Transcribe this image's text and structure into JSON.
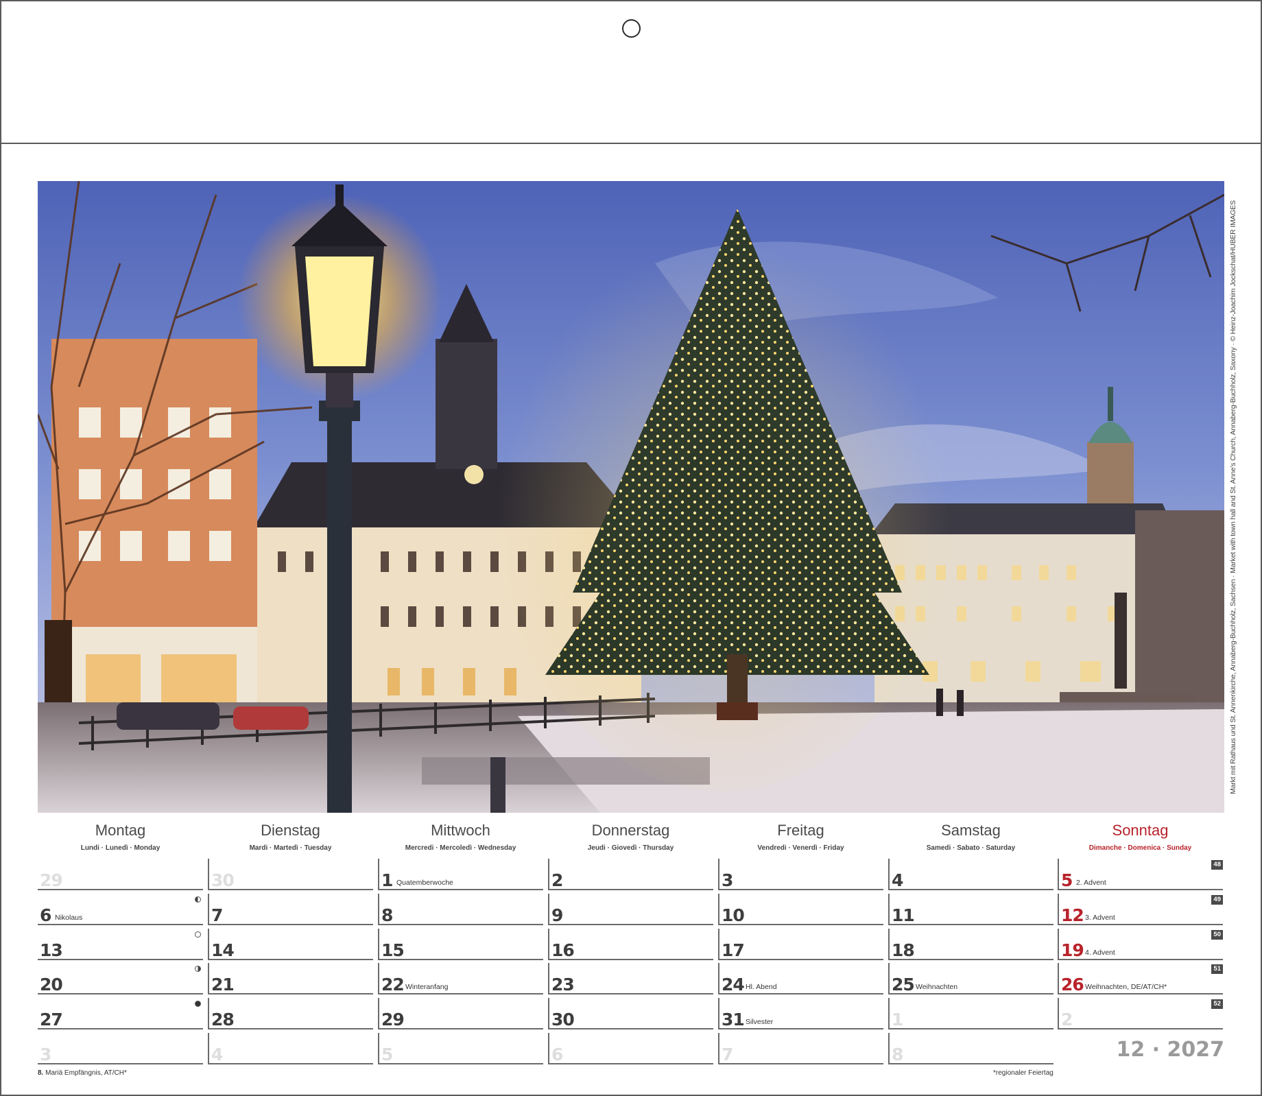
{
  "photo": {
    "credit": "Markt mit Rathaus und St. Annenkirche, Annaberg-Buchholz, Sachsen · Market with town hall and St. Anne’s Church, Annaberg-Buchholz, Saxony · © Heinz-Joachim Jockschat/HUBER IMAGES"
  },
  "weekdays": [
    {
      "name": "Montag",
      "sub": "Lundi · Lunedì · Monday"
    },
    {
      "name": "Dienstag",
      "sub": "Mardi · Martedì · Tuesday"
    },
    {
      "name": "Mittwoch",
      "sub": "Mercredi · Mercoledì · Wednesday"
    },
    {
      "name": "Donnerstag",
      "sub": "Jeudi · Giovedì · Thursday"
    },
    {
      "name": "Freitag",
      "sub": "Vendredi · Venerdì · Friday"
    },
    {
      "name": "Samstag",
      "sub": "Samedi · Sabato · Saturday"
    },
    {
      "name": "Sonntag",
      "sub": "Dimanche · Domenica · Sunday"
    }
  ],
  "weeks": [
    {
      "week_no": "48",
      "days": [
        {
          "n": "29",
          "state": "dim"
        },
        {
          "n": "30",
          "state": "dim"
        },
        {
          "n": "1",
          "note": "Quatemberwoche"
        },
        {
          "n": "2"
        },
        {
          "n": "3"
        },
        {
          "n": "4"
        },
        {
          "n": "5",
          "state": "red",
          "note": "2. Advent"
        }
      ]
    },
    {
      "week_no": "49",
      "days": [
        {
          "n": "6",
          "note": "Nikolaus",
          "moon": "lq"
        },
        {
          "n": "7"
        },
        {
          "n": "8"
        },
        {
          "n": "9"
        },
        {
          "n": "10"
        },
        {
          "n": "11"
        },
        {
          "n": "12",
          "state": "red",
          "note": "3. Advent"
        }
      ]
    },
    {
      "week_no": "50",
      "days": [
        {
          "n": "13",
          "moon": "full"
        },
        {
          "n": "14"
        },
        {
          "n": "15"
        },
        {
          "n": "16"
        },
        {
          "n": "17"
        },
        {
          "n": "18"
        },
        {
          "n": "19",
          "state": "red",
          "note": "4. Advent"
        }
      ]
    },
    {
      "week_no": "51",
      "days": [
        {
          "n": "20",
          "moon": "fq"
        },
        {
          "n": "21"
        },
        {
          "n": "22",
          "note": "Winteranfang"
        },
        {
          "n": "23"
        },
        {
          "n": "24",
          "note": "Hl. Abend"
        },
        {
          "n": "25",
          "note": "Weihnachten"
        },
        {
          "n": "26",
          "state": "red",
          "note": "Weihnachten, DE/AT/CH*"
        }
      ]
    },
    {
      "week_no": "52",
      "days": [
        {
          "n": "27",
          "moon": "new"
        },
        {
          "n": "28"
        },
        {
          "n": "29"
        },
        {
          "n": "30"
        },
        {
          "n": "31",
          "note": "Silvester"
        },
        {
          "n": "1",
          "state": "dim"
        },
        {
          "n": "2",
          "state": "dim"
        }
      ]
    },
    {
      "week_no": "",
      "days": [
        {
          "n": "3",
          "state": "dim"
        },
        {
          "n": "4",
          "state": "dim"
        },
        {
          "n": "5",
          "state": "dim"
        },
        {
          "n": "6",
          "state": "dim"
        },
        {
          "n": "7",
          "state": "dim"
        },
        {
          "n": "8",
          "state": "dim"
        }
      ]
    }
  ],
  "month_year": "12 · 2027",
  "footer": {
    "holiday_day": "8.",
    "holiday_text": " Mariä Empfängnis, AT/CH*",
    "regional_note": "*regionaler Feiertag"
  },
  "colors": {
    "sunday_red": "#b8232b",
    "grid_line": "#6a6a6a",
    "week_badge": "#4a4a4a"
  }
}
